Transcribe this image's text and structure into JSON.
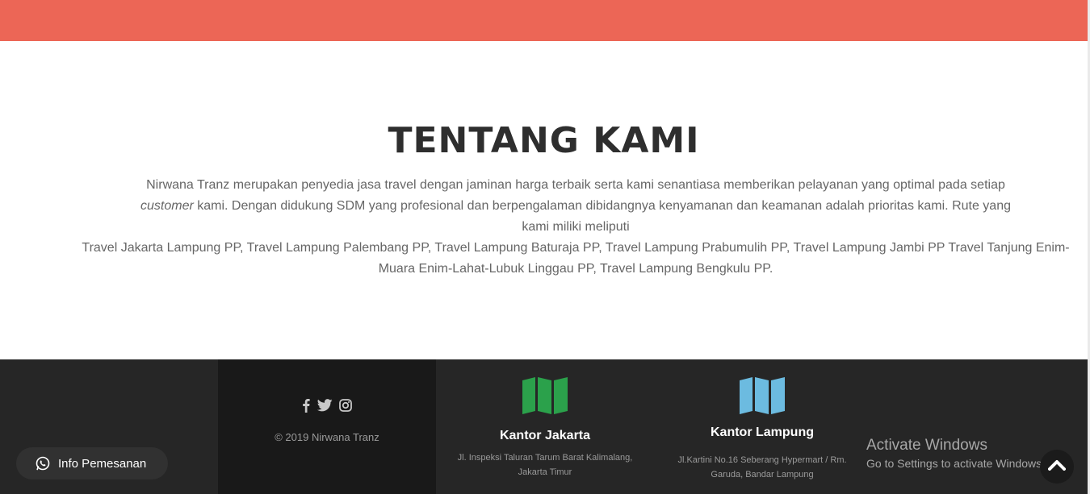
{
  "about": {
    "title": "TENTANG KAMI",
    "intro_before": "Nirwana Tranz merupakan penyedia jasa travel dengan jaminan harga terbaik serta kami senantiasa memberikan pelayanan yang optimal pada setiap ",
    "intro_em": "customer",
    "intro_after": " kami. Dengan didukung SDM yang profesional dan berpengalaman dibidangnya kenyamanan dan keamanan adalah prioritas kami. Rute yang kami miliki meliputi",
    "routes": "Travel Jakarta Lampung PP, Travel Lampung Palembang PP, Travel Lampung Baturaja PP, Travel Lampung Prabumulih PP, Travel Lampung Jambi PP Travel Tanjung Enim-Muara Enim-Lahat-Lubuk Linggau PP, Travel Lampung Bengkulu PP."
  },
  "footer": {
    "social_icons": [
      "facebook-icon",
      "twitter-icon",
      "instagram-icon"
    ],
    "copyright": "© 2019 Nirwana Tranz",
    "offices": [
      {
        "title": "Kantor Jakarta",
        "address": "Jl. Inspeksi Taluran Tarum Barat Kalimalang, Jakarta Timur",
        "icon": "map-icon",
        "icon_color": "#2ba14b"
      },
      {
        "title": "Kantor Lampung",
        "address": "Jl.Kartini No.16 Seberang Hypermart / Rm. Garuda, Bandar Lampung",
        "icon": "map-icon",
        "icon_color": "#6cbbe0"
      }
    ]
  },
  "watermark": {
    "title": "Activate Windows",
    "subtitle": "Go to Settings to activate Windows."
  },
  "whatsapp_button": {
    "label": "Info Pemesanan",
    "icon": "whatsapp-icon"
  },
  "back_to_top": {
    "icon": "chevron-up-icon"
  },
  "colors": {
    "accent": "#ec6656",
    "footer_bg": "#262626",
    "footer_dark": "#191919",
    "text_muted": "#666666"
  }
}
